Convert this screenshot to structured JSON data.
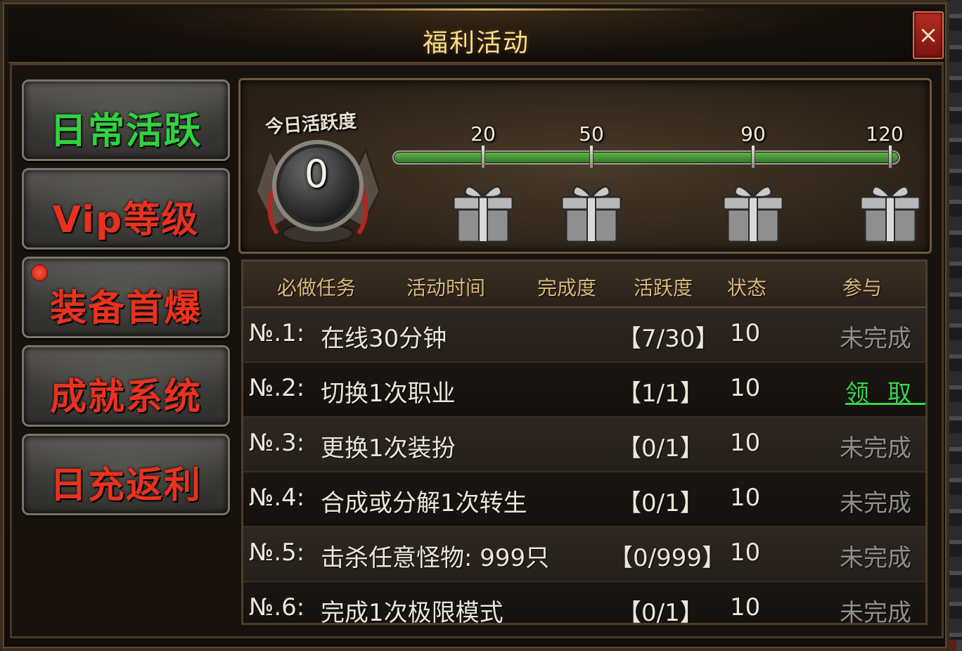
{
  "window": {
    "title": "福利活动",
    "close_icon": "×"
  },
  "sidebar": {
    "items": [
      {
        "label": "日常活跃",
        "color": "#2fd43f",
        "active": true,
        "notify": false
      },
      {
        "label": "Vip等级",
        "color": "#e8321f",
        "active": false,
        "notify": false
      },
      {
        "label": "装备首爆",
        "color": "#e8321f",
        "active": false,
        "notify": true
      },
      {
        "label": "成就系统",
        "color": "#e8321f",
        "active": false,
        "notify": false
      },
      {
        "label": "日充返利",
        "color": "#e8321f",
        "active": false,
        "notify": false
      }
    ]
  },
  "activity": {
    "label": "今日活跃度",
    "value": "0",
    "max": 120,
    "current": 120,
    "milestones": [
      {
        "value": "20",
        "reward_icon": "gift-box-icon"
      },
      {
        "value": "50",
        "reward_icon": "gift-box-icon"
      },
      {
        "value": "90",
        "reward_icon": "gift-box-icon"
      },
      {
        "value": "120",
        "reward_icon": "gift-box-icon"
      }
    ]
  },
  "table": {
    "headers": {
      "task": "必做任务",
      "time": "活动时间",
      "progress": "完成度",
      "activity": "活跃度",
      "state": "状态",
      "join": "参与"
    },
    "rows": [
      {
        "no": "№.1:",
        "name": "在线30分钟",
        "progress": "【7/30】",
        "activity": "10",
        "status": "未完成",
        "claimable": false
      },
      {
        "no": "№.2:",
        "name": "切换1次职业",
        "progress": "【1/1】",
        "activity": "10",
        "status": "领取",
        "claimable": true
      },
      {
        "no": "№.3:",
        "name": "更换1次装扮",
        "progress": "【0/1】",
        "activity": "10",
        "status": "未完成",
        "claimable": false
      },
      {
        "no": "№.4:",
        "name": "合成或分解1次转生",
        "progress": "【0/1】",
        "activity": "10",
        "status": "未完成",
        "claimable": false
      },
      {
        "no": "№.5:",
        "name": "击杀任意怪物: 999只",
        "progress": "【0/999】",
        "activity": "10",
        "status": "未完成",
        "claimable": false
      },
      {
        "no": "№.6:",
        "name": "完成1次极限模式",
        "progress": "【0/1】",
        "activity": "10",
        "status": "未完成",
        "claimable": false
      }
    ]
  }
}
